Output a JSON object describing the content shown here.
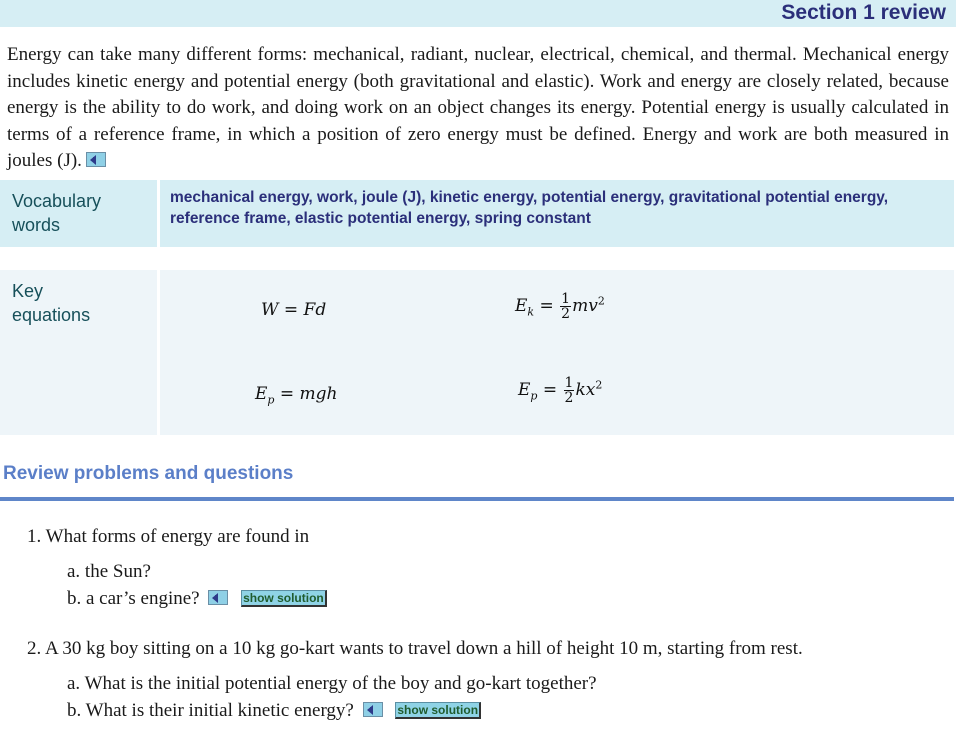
{
  "header": {
    "title": "Section 1 review"
  },
  "intro": {
    "text": "Energy can take many different forms: mechanical, radiant, nuclear, electrical, chemical, and thermal. Mechanical energy includes kinetic energy and potential energy (both gravitational and elastic). Work and energy are closely related, because energy is the ability to do work, and doing work on an object changes its energy. Potential energy is usually calculated in terms of a reference frame, in which a position of zero energy must be defined. Energy and work are both measured in joules (J).",
    "audio_icon": "speaker-icon"
  },
  "vocabulary": {
    "label": "Vocabulary words",
    "words": "mechanical energy, work, joule (J), kinetic energy, potential energy, gravitational potential energy, reference frame, elastic potential energy, spring constant"
  },
  "key_equations": {
    "label": "Key equations",
    "equations": [
      {
        "lhs": "W",
        "rhs": "Fd"
      },
      {
        "lhs": "E",
        "sub": "k",
        "frac_num": "1",
        "frac_den": "2",
        "rhs": "mv",
        "sup": "2"
      },
      {
        "lhs": "E",
        "sub": "p",
        "rhs": "mgh"
      },
      {
        "lhs": "E",
        "sub": "p",
        "frac_num": "1",
        "frac_den": "2",
        "rhs": "kx",
        "sup": "2"
      }
    ]
  },
  "review": {
    "title": "Review problems and questions",
    "questions": [
      {
        "text": "1. What forms of energy are found in",
        "parts": [
          "a. the Sun?",
          "b. a car’s engine?"
        ],
        "solution_label": "show solution"
      },
      {
        "text": "2. A 30 kg boy sitting on a 10 kg go-kart wants to travel down a hill of height 10 m, starting from rest.",
        "parts": [
          "a. What is the initial potential energy of the boy and go-kart together?",
          "b. What is their initial kinetic energy?"
        ],
        "solution_label": "show solution"
      }
    ]
  }
}
